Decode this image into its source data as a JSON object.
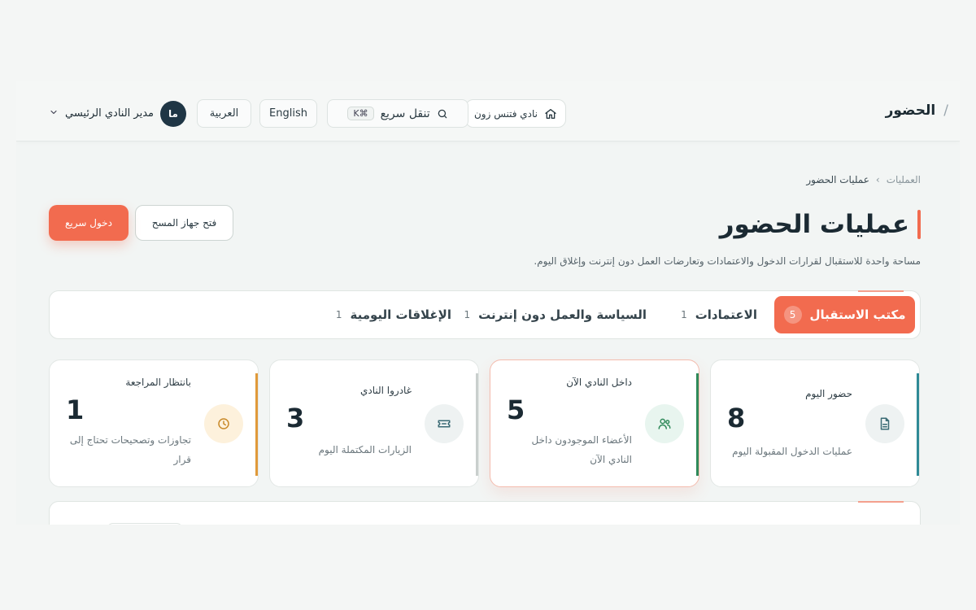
{
  "header": {
    "title": "الحضور",
    "club_name": "نادي فتنس زون",
    "search_label": "تنقل سريع",
    "search_shortcut": "⌘K",
    "lang_en": "English",
    "lang_ar": "العربية",
    "user_name": "مدير النادي الرئيسي",
    "user_initials": "ما"
  },
  "breadcrumb": {
    "root": "العمليات",
    "current": "عمليات الحضور"
  },
  "page": {
    "title": "عمليات الحضور",
    "subtitle": "مساحة واحدة للاستقبال لقرارات الدخول والاعتمادات وتعارضات العمل دون إنترنت وإغلاق اليوم.",
    "scan_button": "فتح جهاز المسح",
    "quick_button": "دخول سريع"
  },
  "tabs": [
    {
      "label": "مكتب الاستقبال",
      "count": "5"
    },
    {
      "label": "الاعتمادات",
      "count": "1"
    },
    {
      "label": "السياسة والعمل دون إنترنت",
      "count": "1"
    },
    {
      "label": "الإغلاقات اليومية",
      "count": "1"
    }
  ],
  "stats": [
    {
      "label": "حضور اليوم",
      "value": "8",
      "desc": "عمليات الدخول المقبولة اليوم",
      "icon": "document-icon",
      "color": "#2f8a96"
    },
    {
      "label": "داخل النادي الآن",
      "value": "5",
      "desc": "الأعضاء الموجودون داخل النادي الآن",
      "icon": "users-icon",
      "color": "#2f8a5a"
    },
    {
      "label": "غادروا النادي",
      "value": "3",
      "desc": "الزيارات المكتملة اليوم",
      "icon": "ticket-icon",
      "color": "#c9cfcd"
    },
    {
      "label": "بانتظار المراجعة",
      "value": "1",
      "desc": "تجاوزات وتصحيحات تحتاج إلى قرار",
      "icon": "clock-icon",
      "color": "#e09a3a"
    }
  ]
}
